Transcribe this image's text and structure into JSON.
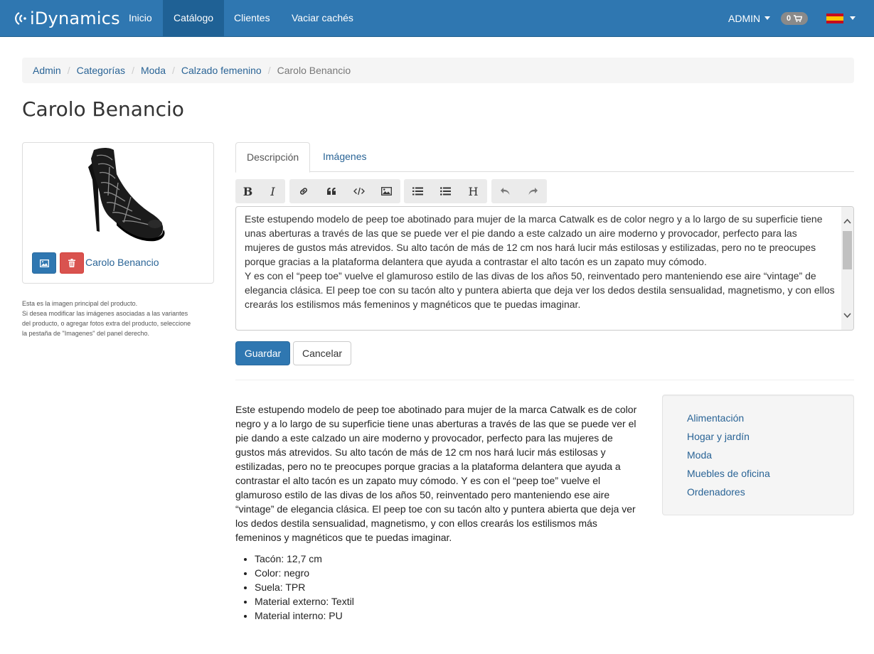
{
  "navbar": {
    "brand": "iDynamics",
    "links": [
      "Inicio",
      "Catálogo",
      "Clientes",
      "Vaciar cachés"
    ],
    "active_link": "Catálogo",
    "user": "ADMIN",
    "cart_count": "0",
    "language": "es"
  },
  "breadcrumb": {
    "items": [
      "Admin",
      "Categorías",
      "Moda",
      "Calzado femenino"
    ],
    "current": "Carolo Benancio"
  },
  "page": {
    "title": "Carolo Benancio"
  },
  "image_panel": {
    "name": "Carolo Benancio",
    "help_lines": [
      "Esta es la imagen principal del producto.",
      "Si desea modificar las imágenes asociadas a las variantes",
      "del producto, o agregar fotos extra del producto, seleccione",
      "la pestaña de \"Imagenes\" del panel derecho."
    ]
  },
  "tabs": [
    "Descripción",
    "Imágenes"
  ],
  "toolbar": {
    "groups": [
      [
        "bold-icon",
        "italic-icon"
      ],
      [
        "link-icon",
        "quote-icon",
        "code-icon",
        "image-icon"
      ],
      [
        "bullet-list-icon",
        "numbered-list-icon",
        "heading-icon"
      ],
      [
        "undo-icon",
        "redo-icon"
      ]
    ],
    "bold_label": "B",
    "italic_label": "I",
    "heading_label": "H"
  },
  "editor": {
    "paragraphs": [
      "Este estupendo modelo de peep toe abotinado para mujer de la marca Catwalk es de color negro y a lo largo de su superficie tiene unas aberturas a través de las que se puede ver el pie dando a este calzado un aire moderno y provocador, perfecto para las mujeres de gustos más atrevidos. Su alto tacón de más de 12 cm nos hará lucir más estilosas y estilizadas, pero no te preocupes porque gracias a la plataforma delantera que ayuda a contrastar el alto tacón es un zapato muy cómodo.",
      "Y es con el “peep toe” vuelve el glamuroso estilo de las divas de los años 50, reinventado pero manteniendo ese aire “vintage” de elegancia clásica. El peep toe con su tacón alto y puntera abierta que deja ver los dedos destila sensualidad, magnetismo, y con ellos crearás los estilismos más femeninos y magnéticos que te puedas imaginar."
    ]
  },
  "actions": {
    "save": "Guardar",
    "cancel": "Cancelar"
  },
  "description": {
    "text": "Este estupendo modelo de peep toe abotinado para mujer de la marca Catwalk es de color negro y a lo largo de su superficie tiene unas aberturas a través de las que se puede ver el pie dando a este calzado un aire moderno y provocador, perfecto para las mujeres de gustos más atrevidos. Su alto tacón de más de 12 cm nos hará lucir más estilosas y estilizadas, pero no te preocupes porque gracias a la plataforma delantera que ayuda a contrastar el alto tacón es un zapato muy cómodo. Y es con el “peep toe” vuelve el glamuroso estilo de las divas de los años 50, reinventado pero manteniendo ese aire “vintage” de elegancia clásica. El peep toe con su tacón alto y puntera abierta que deja ver los dedos destila sensualidad, magnetismo, y con ellos crearás los estilismos más femeninos y magnéticos que te puedas imaginar.",
    "specs": [
      "Tacón: 12,7 cm",
      "Color: negro",
      "Suela: TPR",
      "Material externo: Textil",
      "Material interno: PU"
    ]
  },
  "categories": [
    "Alimentación",
    "Hogar y jardín",
    "Moda",
    "Muebles de oficina",
    "Ordenadores"
  ],
  "colors": {
    "navbar": "#2f77b1",
    "navbar_active": "#1f6195",
    "link": "#2a6496",
    "primary": "#2f77b1",
    "danger": "#d9534f"
  }
}
